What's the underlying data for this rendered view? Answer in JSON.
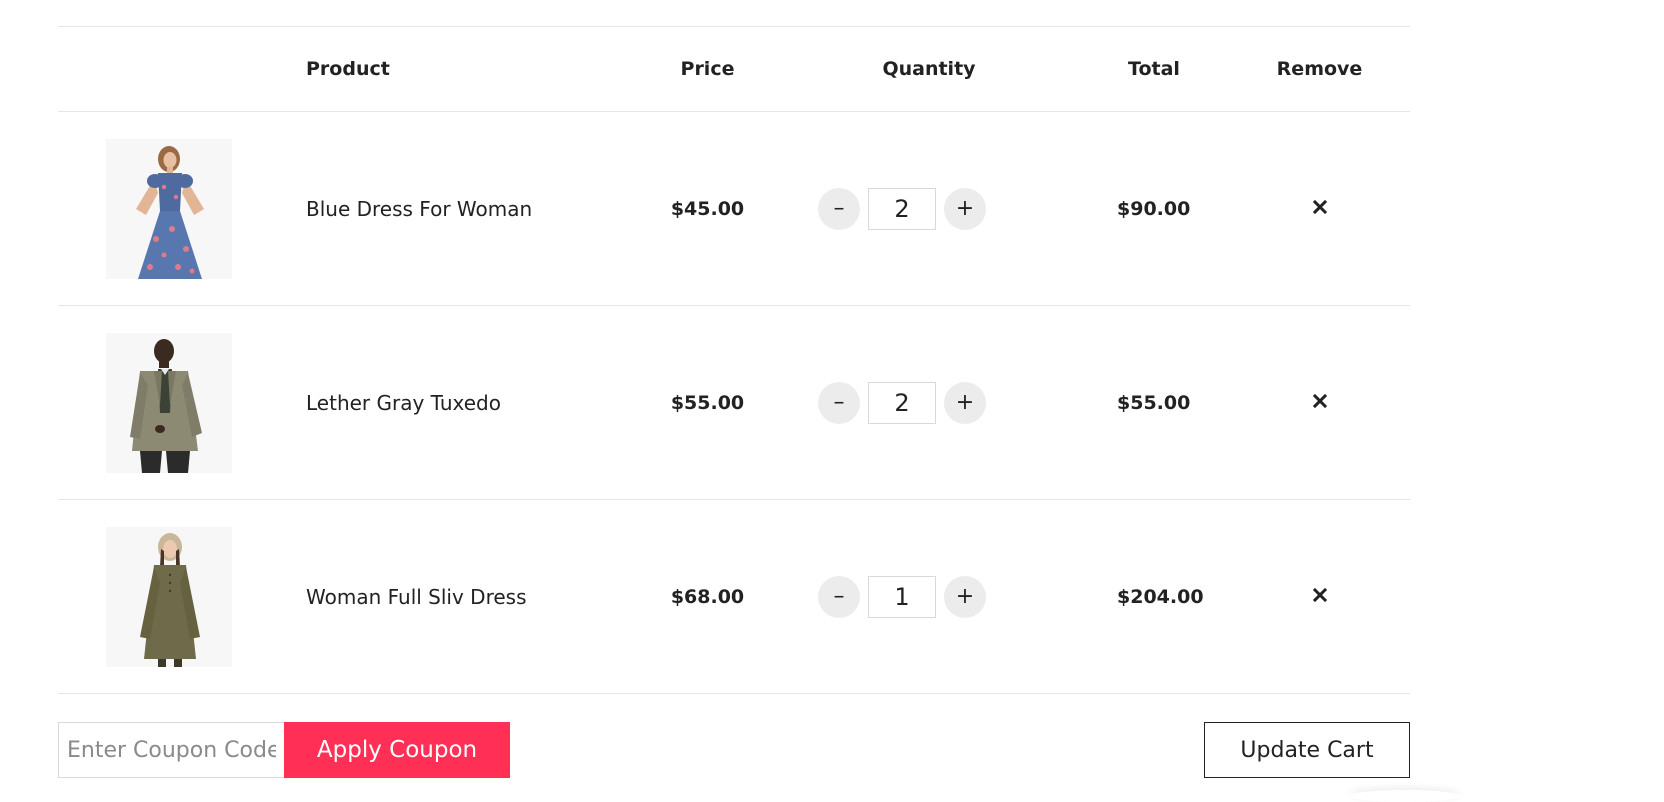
{
  "table": {
    "headers": {
      "product": "Product",
      "price": "Price",
      "quantity": "Quantity",
      "total": "Total",
      "remove": "Remove"
    },
    "rows": [
      {
        "image": "woman-blue-floral-dress-photo",
        "name": "Blue Dress For Woman",
        "price": "$45.00",
        "quantity": "2",
        "total": "$90.00",
        "minus": "–",
        "plus": "+",
        "remove_icon": "close-icon"
      },
      {
        "image": "man-gray-tuxedo-photo",
        "name": "Lether Gray Tuxedo",
        "price": "$55.00",
        "quantity": "2",
        "total": "$55.00",
        "minus": "–",
        "plus": "+",
        "remove_icon": "close-icon"
      },
      {
        "image": "woman-olive-long-sleeve-dress-photo",
        "name": "Woman Full Sliv Dress",
        "price": "$68.00",
        "quantity": "1",
        "total": "$204.00",
        "minus": "–",
        "plus": "+",
        "remove_icon": "close-icon"
      }
    ]
  },
  "coupon": {
    "placeholder": "Enter Coupon Code",
    "value": "",
    "apply_label": "Apply Coupon"
  },
  "update_cart_label": "Update Cart",
  "colors": {
    "accent": "#ff2f55",
    "text": "#222222",
    "border": "#e6e6e6",
    "qty_button_bg": "#ececec"
  }
}
